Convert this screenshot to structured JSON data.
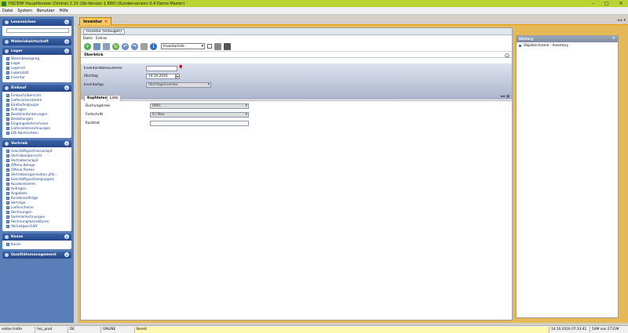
{
  "window": {
    "title": "HSCERP Hauptfenster (Online) 2.15 (Db-Version 1.660) (Kundenversion 0.4 Demo Master)"
  },
  "menu": [
    "Datei",
    "System",
    "Benutzer",
    "Hilfe"
  ],
  "sidebar": {
    "groups": [
      {
        "title": "Lesezeichen",
        "items": []
      },
      {
        "title": "Materialwirtschaft",
        "items": []
      },
      {
        "title": "Lager",
        "items": [
          "Warenbewegung",
          "Lager",
          "Lagerort",
          "Lagerplatz",
          "Inventur"
        ]
      },
      {
        "title": "Einkauf",
        "items": [
          "Einkaufsübersicht",
          "Lieferantenstamm",
          "Einkäufergruppe",
          "Anfragen",
          "Bestellanforderungen",
          "Bestellungen",
          "Eingangslieferscheine",
          "Lieferantenrechnungen",
          "EDI Nachrichten"
        ]
      },
      {
        "title": "Vertrieb",
        "items": [
          "Geschäftspartnercockpit",
          "Vertriebsübersicht",
          "Vertriebscockpit",
          "Offene Belege",
          "Offene Posten",
          "Vertriebsorganisation pfle...",
          "Geschäftspartnergruppen",
          "Kundenstamm",
          "Anfragen",
          "Angebote",
          "Kundenaufträge",
          "Verträge",
          "Lieferscheine",
          "Rechnungen",
          "Sammelrechnungen",
          "Rechnungskorrekturen",
          "Verlustgeschäft"
        ]
      },
      {
        "title": "Kasse",
        "items": [
          "Kasse"
        ]
      },
      {
        "title": "Qualitätsmanagement",
        "items": []
      }
    ]
  },
  "tabs": [
    {
      "label": "Inventur"
    }
  ],
  "doc": {
    "breadcrumb": "Inventur (erzeugen)",
    "submenu": [
      "Datei",
      "Extras"
    ],
    "toolbar_select": "Inventurliste",
    "overview_title": "Überblick",
    "fields": {
      "inventory_number_label": "Inventurdatennummer",
      "inventory_number_value": "",
      "reference_date_label": "Stichtag",
      "reference_date_value": "14.10.2016",
      "inventory_type_label": "Inventurtyp",
      "inventory_type_value": "Stichtagsinventur"
    },
    "detail_tabs": [
      "Kopfdaten",
      "Liste"
    ],
    "detail": {
      "booking_period_label": "Buchungskreis",
      "booking_period_value": "0001",
      "progress_label": "Fortschritt",
      "progress_value": "0",
      "progress_status": "Neu",
      "short_text_label": "Kurztext",
      "short_text_value": ""
    }
  },
  "history": {
    "title": "History",
    "items": [
      "Objektschreine - Inventory"
    ]
  },
  "status": {
    "user": "volker.trotte",
    "db": "hsc_prod",
    "lang": "DE",
    "mode": "ONLINE",
    "state": "Bereit",
    "datetime": "14.10.2016 07:33:41",
    "memory": "54M von 2731M"
  },
  "colors": {
    "titlebar": "#b8d432",
    "sidebar": "#5a7fb8",
    "tab_active": "#f8c860",
    "frame": "#e5b858"
  }
}
